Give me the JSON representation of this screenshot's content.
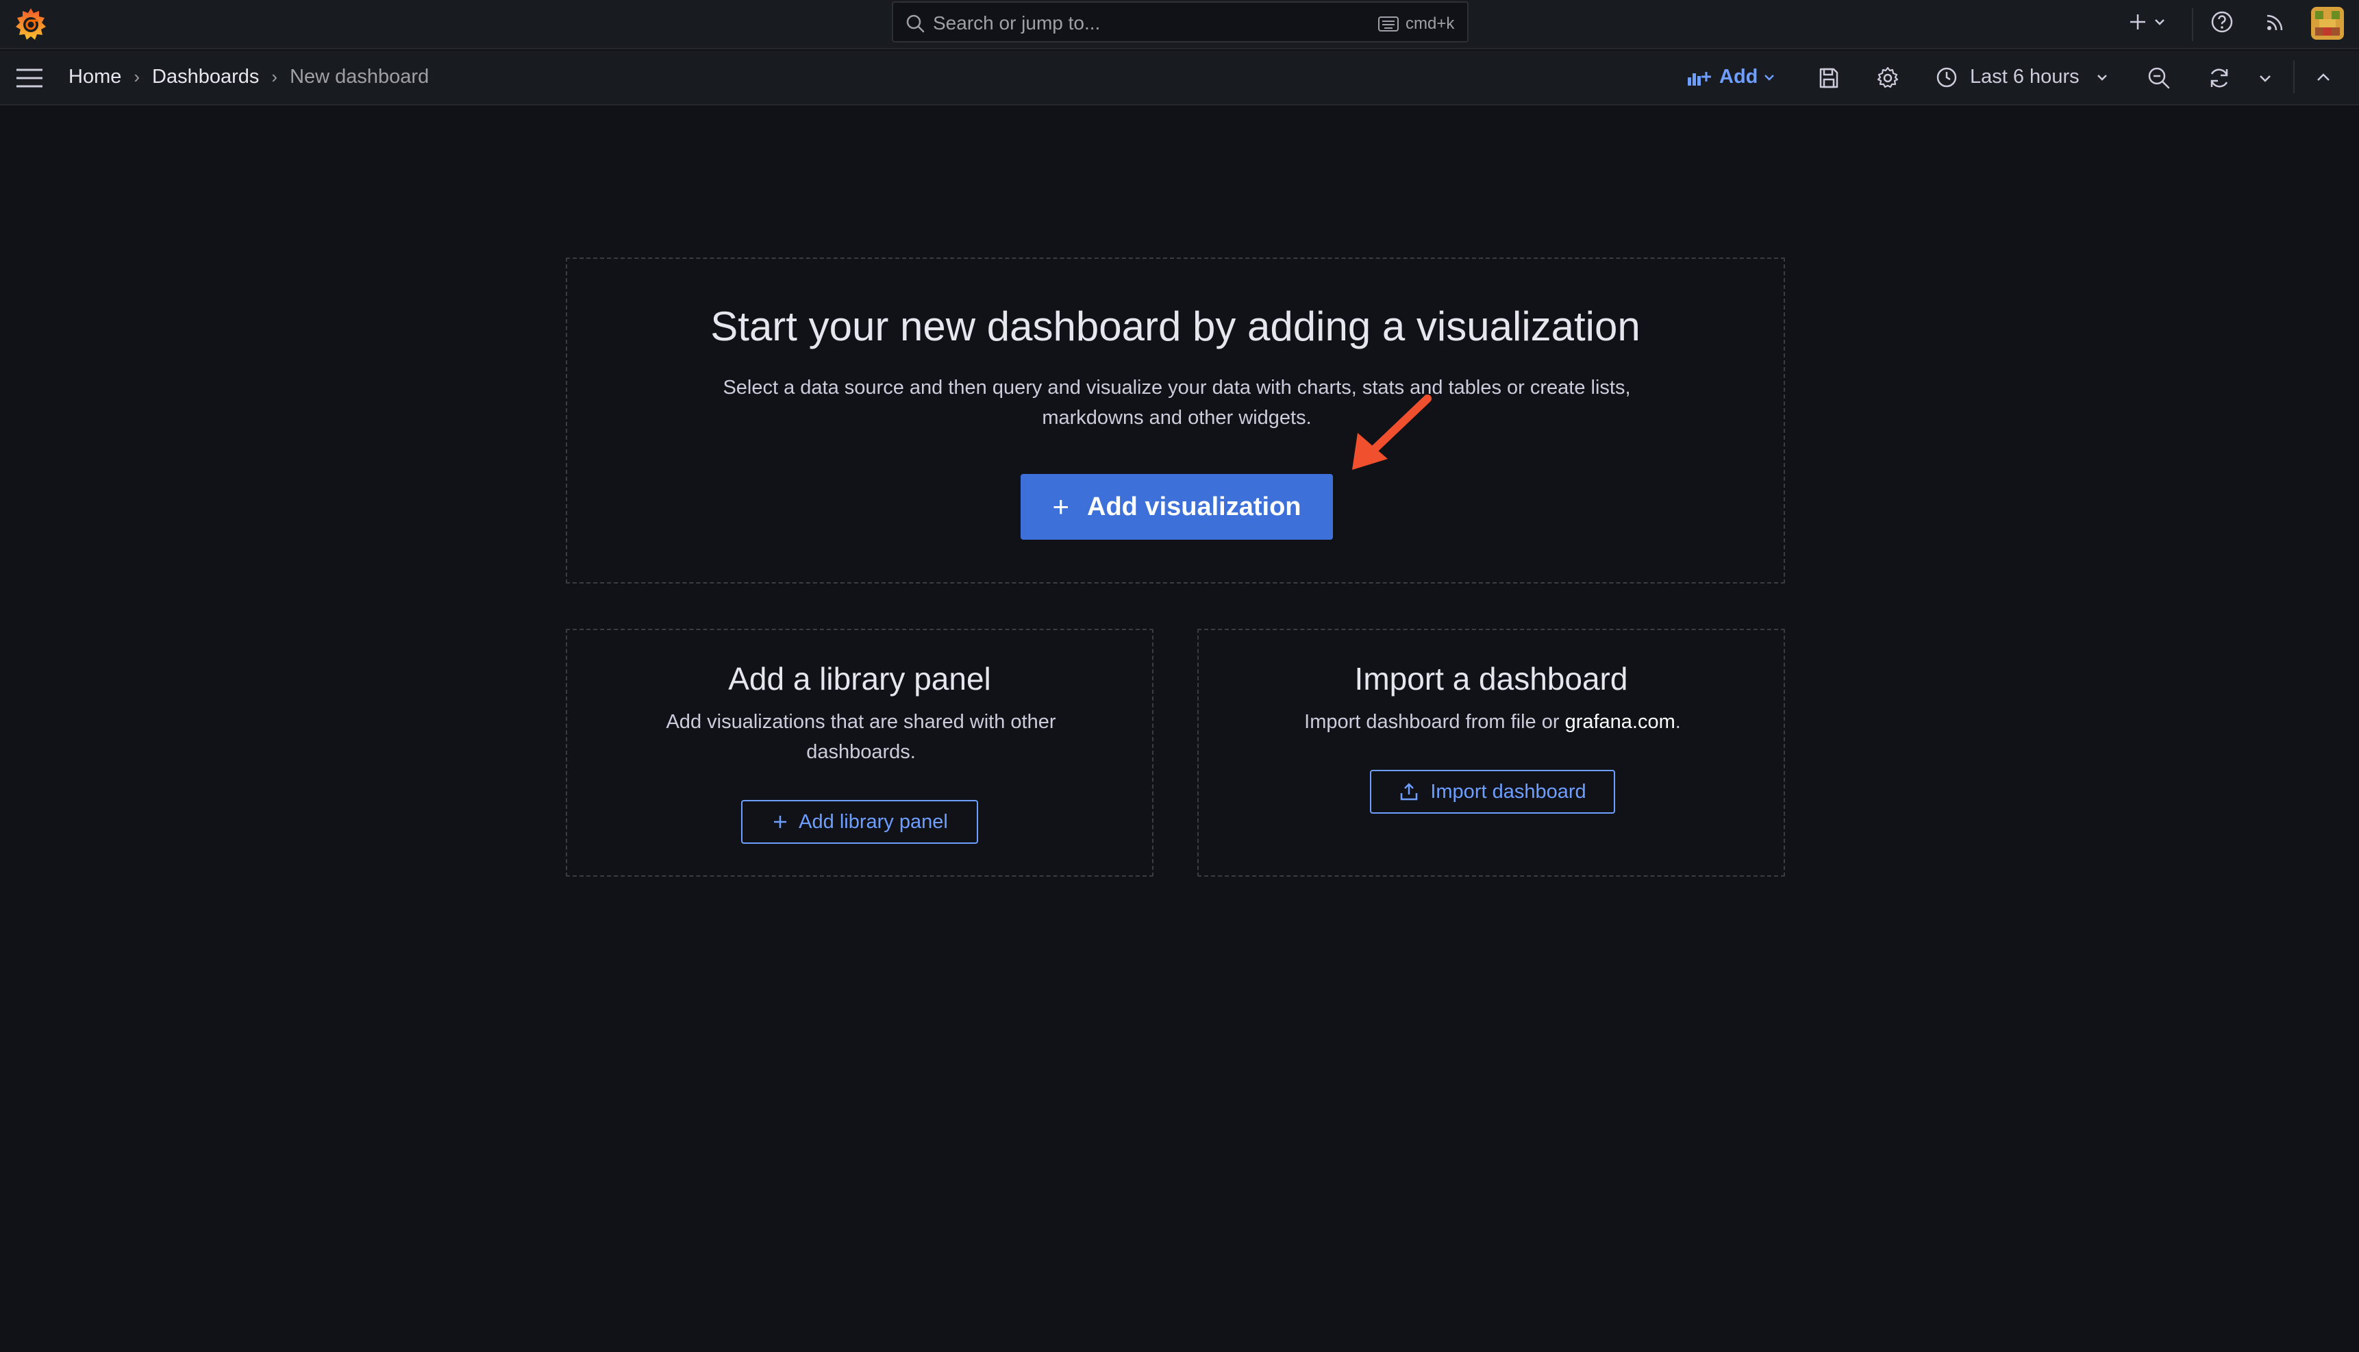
{
  "topbar": {
    "search": {
      "placeholder": "Search or jump to...",
      "shortcut": "cmd+k"
    },
    "icons": [
      "grafana-logo",
      "plus-icon",
      "chevron-down-icon",
      "help-icon",
      "news-feed-icon",
      "user-avatar"
    ]
  },
  "navbar": {
    "breadcrumbs": [
      {
        "label": "Home"
      },
      {
        "label": "Dashboards"
      },
      {
        "label": "New dashboard"
      }
    ],
    "add_label": "Add",
    "time_range": "Last 6 hours"
  },
  "main": {
    "title": "Start your new dashboard by adding a visualization",
    "description": "Select a data source and then query and visualize your data with charts, stats and tables or create lists, markdowns and other widgets.",
    "button_label": "Add visualization"
  },
  "library_panel": {
    "title": "Add a library panel",
    "description": "Add visualizations that are shared with other dashboards.",
    "button_label": "Add library panel"
  },
  "import_panel": {
    "title": "Import a dashboard",
    "description_prefix": "Import dashboard from file or ",
    "description_link": "grafana.com",
    "description_suffix": ".",
    "button_label": "Import dashboard"
  },
  "colors": {
    "background": "#111217",
    "primary": "#3d71d9",
    "link": "#6e9fff",
    "annotation_arrow": "#f0502d",
    "logo_orange": "#f46800"
  }
}
